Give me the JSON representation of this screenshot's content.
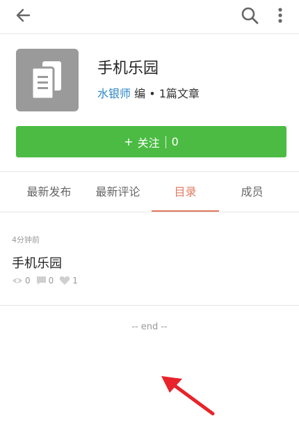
{
  "group": {
    "name": "手机乐园",
    "author": "水银师",
    "meta_rest": " 编 • 1篇文章"
  },
  "follow": {
    "plus": "+",
    "label": "关注",
    "count": "0"
  },
  "tabs": [
    {
      "label": "最新发布"
    },
    {
      "label": "最新评论"
    },
    {
      "label": "目录"
    },
    {
      "label": "成员"
    }
  ],
  "active_tab": 2,
  "post": {
    "time": "4分钟前",
    "title": "手机乐园",
    "views": "0",
    "comments": "0",
    "likes": "1"
  },
  "footer": {
    "end": "-- end --"
  },
  "colors": {
    "accent": "#e07a5f",
    "follow_green": "#4bbb43",
    "author_link": "#2b86c8"
  },
  "icons": [
    "back-arrow-icon",
    "search-icon",
    "more-vertical-icon",
    "document-icon",
    "eye-icon",
    "comment-icon",
    "heart-icon",
    "red-arrow-annotation"
  ]
}
